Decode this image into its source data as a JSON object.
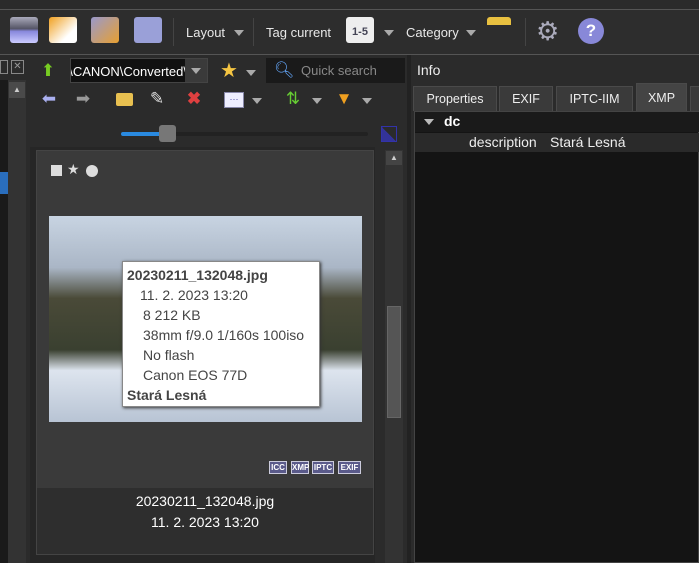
{
  "toolbar": {
    "layout": "Layout",
    "tag_current": "Tag current",
    "rating_badge": "1-5",
    "category": "Category"
  },
  "browser": {
    "path": "\\CANON\\Converted\\",
    "search_placeholder": "Quick search"
  },
  "thumbnail": {
    "tooltip": {
      "filename": "20230211_132048.jpg",
      "date": "11. 2. 2023 13:20",
      "size": "8 212 KB",
      "exposure": "38mm f/9.0 1/160s 100iso",
      "flash": "No flash",
      "camera": "Canon EOS 77D",
      "description": "Stará Lesná"
    },
    "badges": [
      "ICC",
      "XMP",
      "IPTC",
      "EXIF"
    ],
    "caption_name": "20230211_132048.jpg",
    "caption_date": "11. 2. 2023 13:20"
  },
  "info": {
    "title": "Info",
    "tabs": [
      "Properties",
      "EXIF",
      "IPTC-IIM",
      "XMP"
    ],
    "active_tab": "XMP",
    "tree": {
      "group": "dc",
      "key": "description",
      "value": "Stará Lesná"
    }
  },
  "colors": {
    "accent": "#2a6ebd",
    "bg": "#2b2b2b"
  }
}
